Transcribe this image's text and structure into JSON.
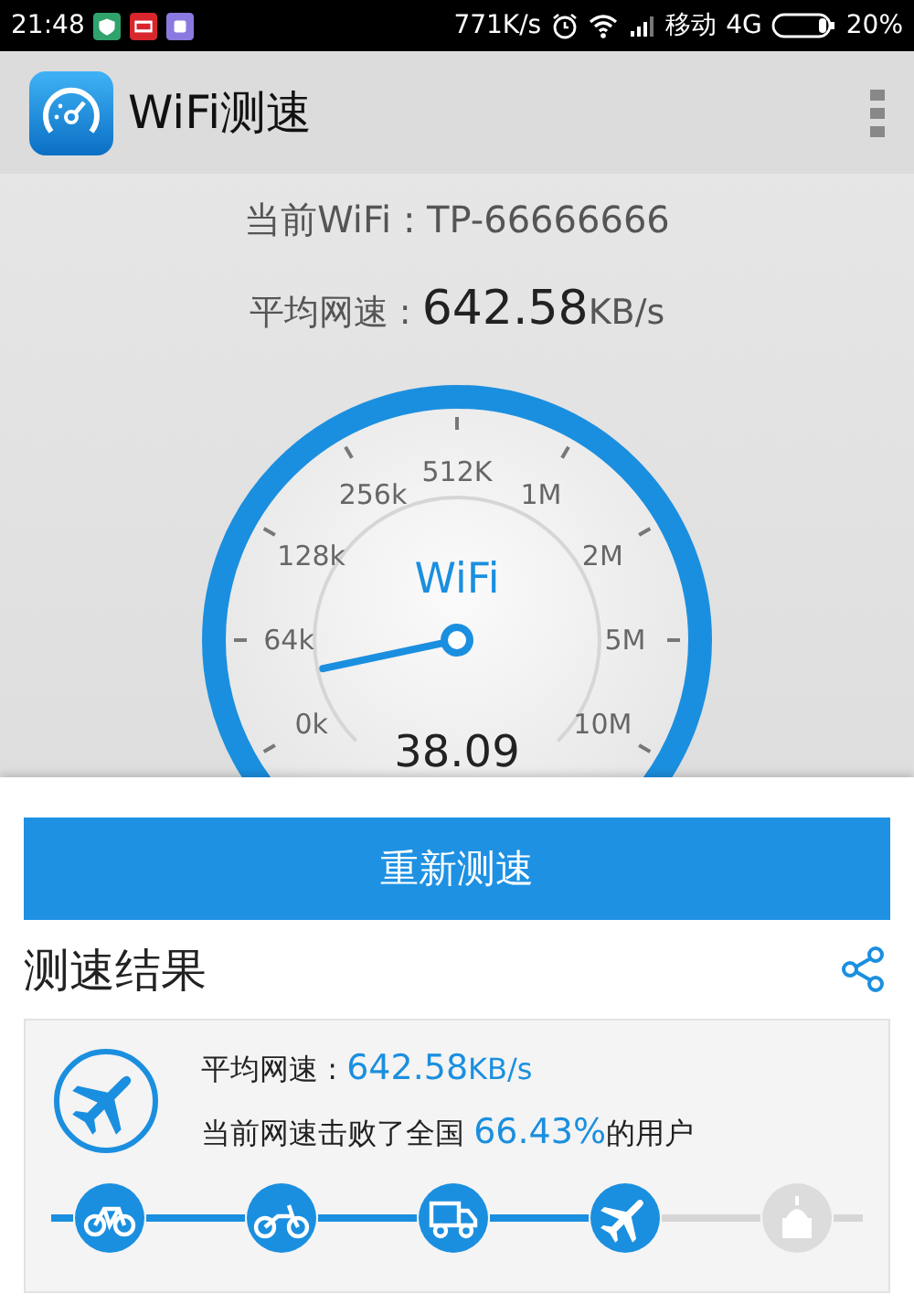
{
  "status_bar": {
    "time": "21:48",
    "net_speed": "771K/s",
    "carrier": "移动",
    "network": "4G",
    "battery": "20%"
  },
  "app_bar": {
    "title": "WiFi测速"
  },
  "info": {
    "wifi_label": "当前WiFi : TP-66666666",
    "speed_label": "平均网速 : ",
    "speed_value": "642.58",
    "speed_unit": "KB/s"
  },
  "gauge": {
    "center_label": "WiFi",
    "ticks": [
      "0k",
      "64k",
      "128k",
      "256k",
      "512K",
      "1M",
      "2M",
      "5M",
      "10M"
    ],
    "reading": "38.09"
  },
  "retest_button": "重新测速",
  "results": {
    "title": "测速结果",
    "speed_label": "平均网速 : ",
    "speed_value": "642.58",
    "speed_unit": "KB/s",
    "rank_prefix": "当前网速击败了全国 ",
    "rank_value": "66.43%",
    "rank_suffix": "的用户",
    "stages": [
      {
        "kind": "bicycle",
        "active": true
      },
      {
        "kind": "motorbike",
        "active": true
      },
      {
        "kind": "truck",
        "active": true
      },
      {
        "kind": "plane",
        "active": true
      },
      {
        "kind": "building",
        "active": false
      }
    ]
  }
}
